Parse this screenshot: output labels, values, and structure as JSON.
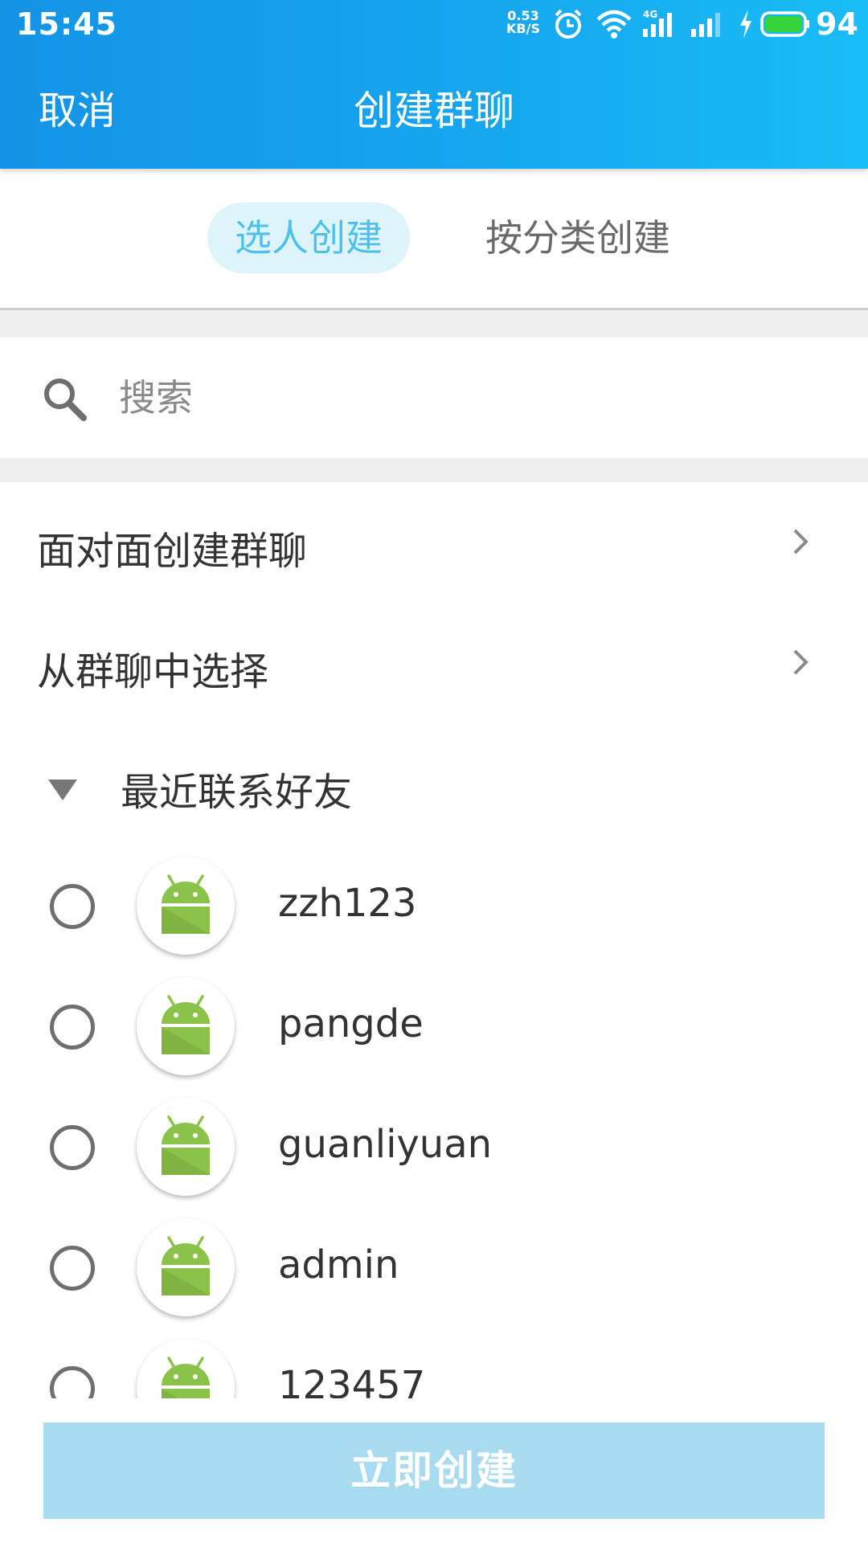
{
  "status_bar": {
    "time": "15:45",
    "net_speed_value": "0.53",
    "net_speed_unit": "KB/S",
    "network_type": "4G",
    "battery_level": "94",
    "icons": [
      "alarm-icon",
      "wifi-icon",
      "signal-4g-icon",
      "signal-icon",
      "charging-icon",
      "battery-icon"
    ]
  },
  "header": {
    "cancel_label": "取消",
    "title": "创建群聊",
    "color_start": "#1593e6",
    "color_end": "#19bdf6"
  },
  "tabs": [
    {
      "label": "选人创建",
      "active": true
    },
    {
      "label": "按分类创建",
      "active": false
    }
  ],
  "search": {
    "placeholder": "搜索",
    "value": ""
  },
  "menu": [
    {
      "label": "面对面创建群聊",
      "icon": "chevron-right-icon"
    },
    {
      "label": "从群聊中选择",
      "icon": "chevron-right-icon"
    }
  ],
  "section": {
    "title": "最近联系好友",
    "expanded": true
  },
  "contacts": [
    {
      "name": "zzh123",
      "selected": false,
      "avatar": "android-avatar-icon"
    },
    {
      "name": "pangde",
      "selected": false,
      "avatar": "android-avatar-icon"
    },
    {
      "name": "guanliyuan",
      "selected": false,
      "avatar": "android-avatar-icon"
    },
    {
      "name": "admin",
      "selected": false,
      "avatar": "android-avatar-icon"
    },
    {
      "name": "123457",
      "selected": false,
      "avatar": "android-avatar-icon"
    }
  ],
  "create_button": {
    "label": "立即创建",
    "enabled": false,
    "color": "#a9dbf0"
  },
  "colors": {
    "accent": "#4cc2ea",
    "tab_active_bg": "#dff3fb",
    "android_green": "#8bc34a"
  }
}
